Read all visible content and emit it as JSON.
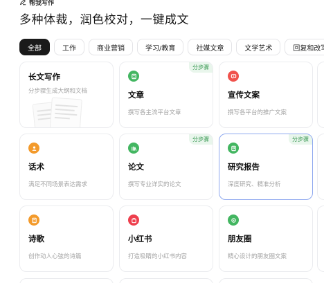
{
  "header": {
    "breadcrumb": "帮我写作",
    "headline": "多种体裁，润色校对，一键成文"
  },
  "tabs": [
    {
      "label": "全部",
      "active": true
    },
    {
      "label": "工作",
      "active": false
    },
    {
      "label": "商业营销",
      "active": false
    },
    {
      "label": "学习/教育",
      "active": false
    },
    {
      "label": "社媒文章",
      "active": false
    },
    {
      "label": "文学艺术",
      "active": false
    },
    {
      "label": "回复和改写",
      "active": false
    }
  ],
  "cards": [
    {
      "title": "长文写作",
      "desc": "分步骤生成大纲和文档",
      "badge": "",
      "icon": "document-illustration",
      "color": ""
    },
    {
      "title": "文章",
      "desc": "撰写各主流平台文章",
      "badge": "分步骤",
      "icon": "article-icon",
      "color": "#43b661"
    },
    {
      "title": "宣传文案",
      "desc": "撰写各平台的推广文案",
      "badge": "",
      "icon": "megaphone-icon",
      "color": "#f0524c"
    },
    {
      "title": "话术",
      "desc": "满足不同场景表达需求",
      "badge": "",
      "icon": "person-icon",
      "color": "#f39a2b"
    },
    {
      "title": "论文",
      "desc": "撰写专业详实的论文",
      "badge": "分步骤",
      "icon": "books-icon",
      "color": "#43b661"
    },
    {
      "title": "研究报告",
      "desc": "深度研究、精准分析",
      "badge": "分步骤",
      "icon": "report-icon",
      "color": "#43b661",
      "selected": true
    },
    {
      "title": "诗歌",
      "desc": "创作动人心弦的诗篇",
      "badge": "",
      "icon": "poem-icon",
      "color": "#f39a2b"
    },
    {
      "title": "小红书",
      "desc": "打造吸睛的小红书内容",
      "badge": "",
      "icon": "xiaohongshu-icon",
      "color": "#ee3f4d"
    },
    {
      "title": "朋友圈",
      "desc": "精心设计的朋友圈文案",
      "badge": "",
      "icon": "moments-icon",
      "color": "#43b661"
    }
  ]
}
